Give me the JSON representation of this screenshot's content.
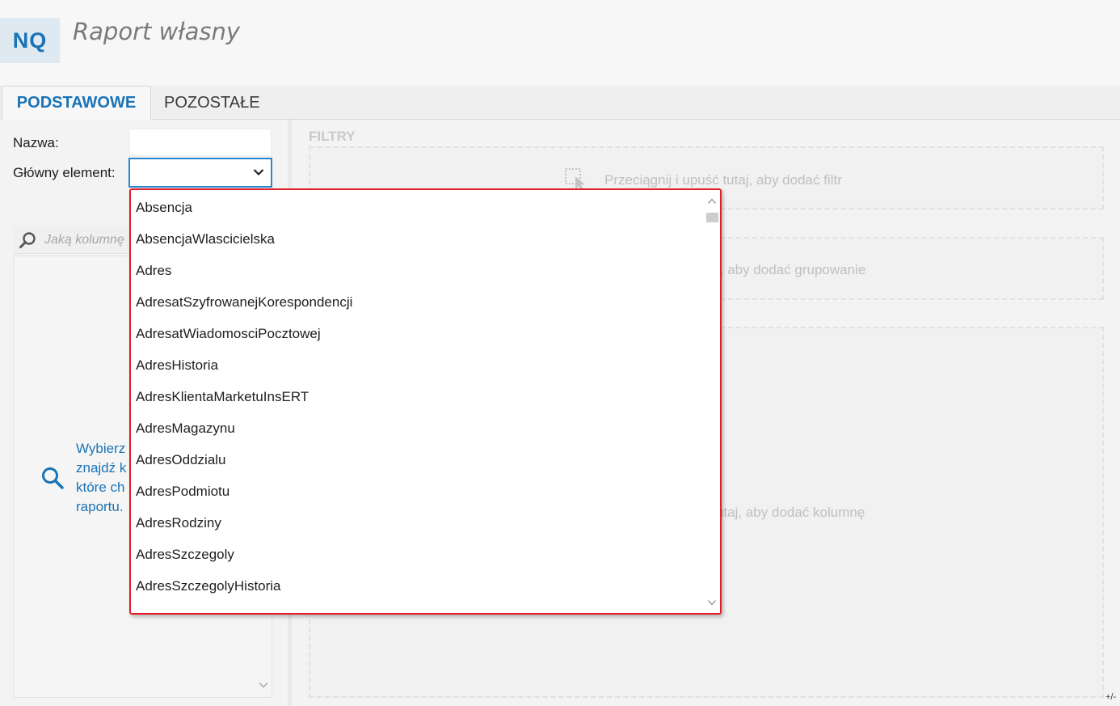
{
  "header": {
    "app_badge": "NQ",
    "title": "Raport własny"
  },
  "tabs": [
    {
      "label": "PODSTAWOWE"
    },
    {
      "label": "POZOSTAŁE"
    }
  ],
  "form": {
    "name_label": "Nazwa:",
    "name_value": "",
    "main_element_label": "Główny element:",
    "main_element_value": ""
  },
  "column_search": {
    "placeholder": "Jaką kolumnę"
  },
  "help_text": {
    "lines": [
      "Wybierz",
      "znajdź k",
      "które ch",
      "raportu."
    ]
  },
  "filters": {
    "section_label": "FILTRY",
    "drop_hint": "Przeciągnij i upuść tutaj, aby dodać filtr"
  },
  "grouping": {
    "drop_hint": "j, aby dodać grupowanie"
  },
  "columns_zone": {
    "drop_hint": "utaj, aby dodać kolumnę"
  },
  "corner_text": "+/-",
  "dropdown": {
    "items": [
      "Absencja",
      "AbsencjaWlascicielska",
      "Adres",
      "AdresatSzyfrowanejKorespondencji",
      "AdresatWiadomosciPocztowej",
      "AdresHistoria",
      "AdresKlientaMarketuInsERT",
      "AdresMagazynu",
      "AdresOddzialu",
      "AdresPodmiotu",
      "AdresRodziny",
      "AdresSzczegoly",
      "AdresSzczegolyHistoria"
    ]
  },
  "colors": {
    "accent": "#1a73b5",
    "highlight_border": "#e0202a",
    "focus_border": "#2a86cf"
  },
  "icons": [
    "search-icon",
    "chevron-down-icon",
    "drag-drop-icon",
    "magnifier-icon",
    "scroll-up-icon",
    "scroll-down-icon"
  ]
}
